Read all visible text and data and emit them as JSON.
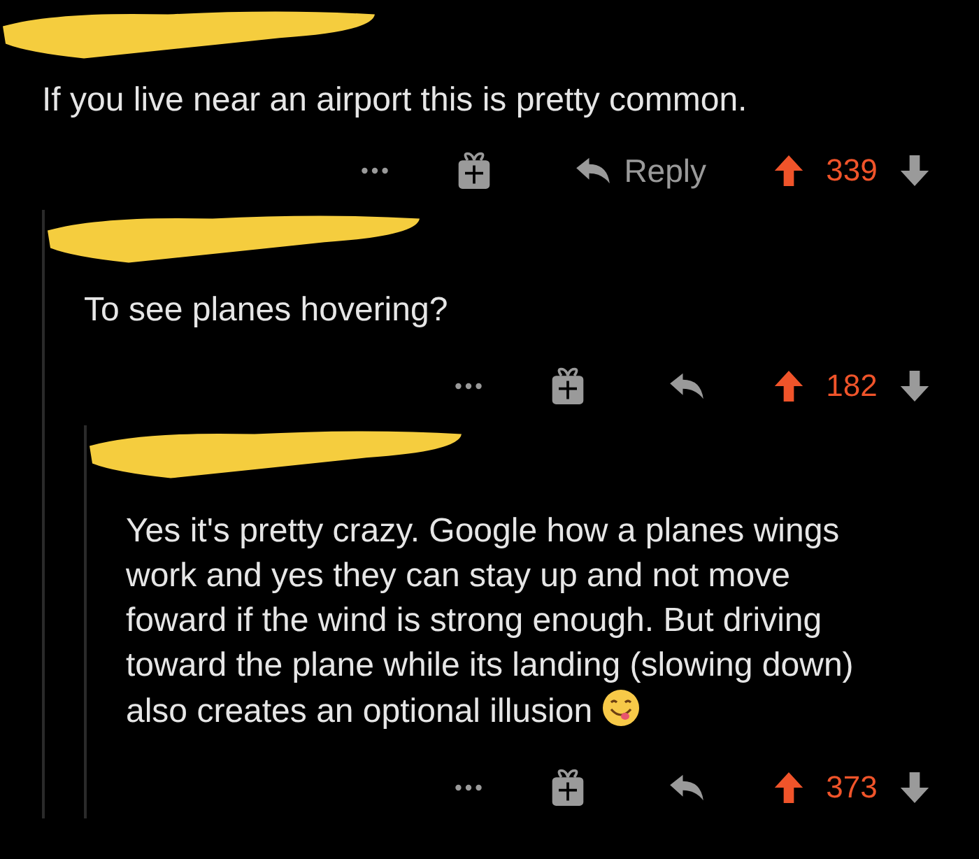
{
  "comments": [
    {
      "text": "If you live near an airport this is pretty common.",
      "emoji": false,
      "reply_label": "Reply",
      "score": "339",
      "upvoted": true,
      "children": [
        {
          "text": "To see planes hovering?",
          "emoji": false,
          "score": "182",
          "upvoted": true,
          "children": [
            {
              "text": "Yes it's pretty crazy.  Google how a planes wings work and yes they can stay up and not move foward if the wind is strong enough. But driving toward the plane while its landing (slowing down) also creates an optional illusion",
              "emoji": true,
              "score": "373",
              "upvoted": true
            }
          ]
        }
      ]
    }
  ]
}
